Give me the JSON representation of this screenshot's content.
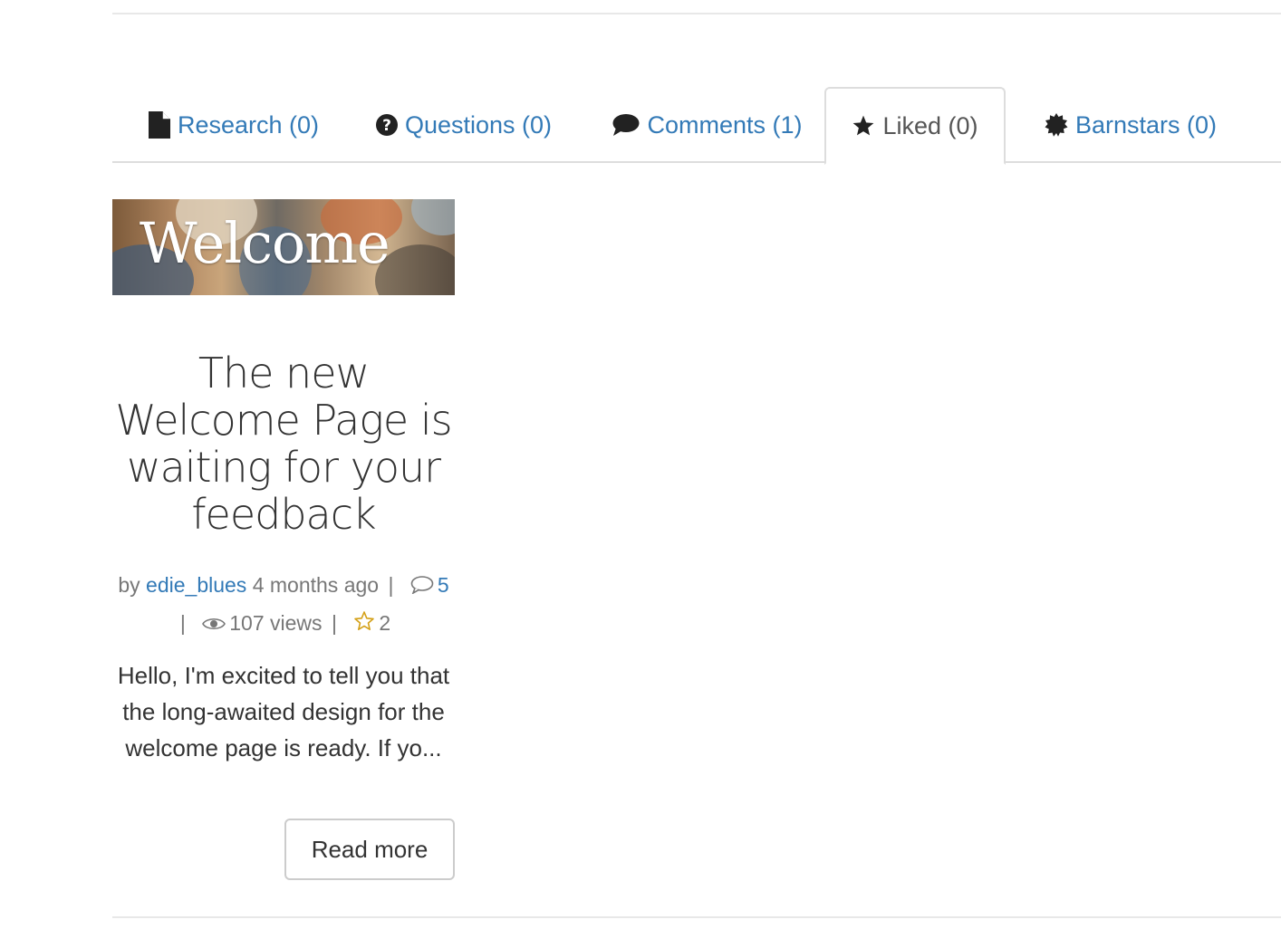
{
  "tabs": [
    {
      "label": "Research (0)",
      "icon": "file-icon"
    },
    {
      "label": "Questions (0)",
      "icon": "question-circle-icon"
    },
    {
      "label": "Comments (1)",
      "icon": "comment-icon"
    },
    {
      "label": "Liked (0)",
      "icon": "star-icon",
      "active": true
    },
    {
      "label": "Barnstars (0)",
      "icon": "certificate-icon"
    }
  ],
  "post": {
    "banner_text": "Welcome",
    "title": "The new Welcome Page is waiting for your feedback",
    "meta": {
      "by": "by",
      "author": "edie_blues",
      "time": "4 months ago",
      "separator": "|",
      "comments_count": "5",
      "views": "107 views",
      "likes": "2"
    },
    "excerpt": "Hello, I'm excited to tell you that the long-awaited design for the welcome page is ready. If yo...",
    "read_more_label": "Read more"
  },
  "colors": {
    "link": "#337ab7",
    "muted": "#777777",
    "text": "#333333",
    "star": "#d4a017",
    "border": "#dddddd"
  }
}
